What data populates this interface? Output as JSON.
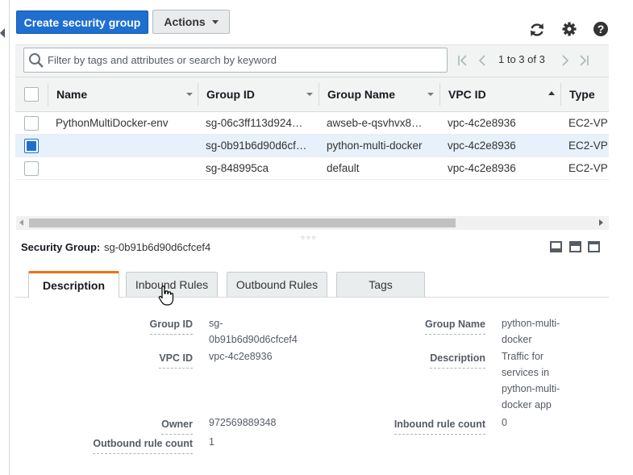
{
  "toolbar": {
    "create_label": "Create security group",
    "actions_label": "Actions",
    "icons": [
      "refresh-icon",
      "gear-icon",
      "help-icon"
    ]
  },
  "search": {
    "placeholder": "Filter by tags and attributes or search by keyword"
  },
  "pagination": {
    "text": "1 to 3 of 3"
  },
  "table": {
    "columns": [
      "Name",
      "Group ID",
      "Group Name",
      "VPC ID",
      "Type"
    ],
    "sorted_column": "VPC ID",
    "rows": [
      {
        "name": "PythonMultiDocker-env",
        "group_id": "sg-06c3ff113d924…",
        "group_name": "awseb-e-qsvhvx8…",
        "vpc_id": "vpc-4c2e8936",
        "type": "EC2-VP",
        "selected": false
      },
      {
        "name": "",
        "group_id": "sg-0b91b6d90d6cf…",
        "group_name": "python-multi-docker",
        "vpc_id": "vpc-4c2e8936",
        "type": "EC2-VP",
        "selected": true
      },
      {
        "name": "",
        "group_id": "sg-848995ca",
        "group_name": "default",
        "vpc_id": "vpc-4c2e8936",
        "type": "EC2-VP",
        "selected": false
      }
    ]
  },
  "detail": {
    "label": "Security Group:",
    "value": "sg-0b91b6d90d6cfcef4",
    "tabs": [
      "Description",
      "Inbound Rules",
      "Outbound Rules",
      "Tags"
    ],
    "active_tab": "Description",
    "fields": {
      "group_id_label": "Group ID",
      "group_id_line1": "sg-",
      "group_id_line2": "0b91b6d90d6cfcef4",
      "vpc_id_label": "VPC ID",
      "vpc_id_value": "vpc-4c2e8936",
      "owner_label": "Owner",
      "owner_value": "972569889348",
      "outbound_label": "Outbound rule count",
      "outbound_value": "1",
      "group_name_label": "Group Name",
      "group_name_line1": "python-multi-",
      "group_name_line2": "docker",
      "description_label": "Description",
      "description_lines": [
        "Traffic for",
        "services in",
        "python-multi-",
        "docker app"
      ],
      "inbound_label": "Inbound rule count",
      "inbound_value": "0"
    }
  },
  "colors": {
    "primary": "#1e6fcf",
    "tab_accent": "#ec7211",
    "selected_row": "#e7f1fb"
  }
}
